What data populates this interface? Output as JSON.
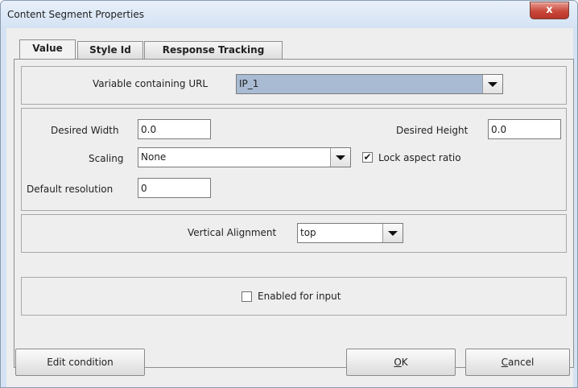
{
  "window": {
    "title": "Content Segment Properties",
    "close_glyph": "x"
  },
  "tabs": [
    {
      "label": "Value",
      "active": true
    },
    {
      "label": "Style Id",
      "active": false
    },
    {
      "label": "Response Tracking",
      "active": false
    }
  ],
  "url_group": {
    "label": "Variable containing URL",
    "value": "IP_1"
  },
  "size_group": {
    "desired_width_label": "Desired Width",
    "desired_width_value": "0.0",
    "desired_height_label": "Desired Height",
    "desired_height_value": "0.0",
    "scaling_label": "Scaling",
    "scaling_value": "None",
    "lock_aspect_label": "Lock aspect ratio",
    "lock_aspect_checked": true,
    "default_resolution_label": "Default resolution",
    "default_resolution_value": "0"
  },
  "alignment_group": {
    "label": "Vertical Alignment",
    "value": "top"
  },
  "input_group": {
    "label": "Enabled for input",
    "checked": false
  },
  "buttons": {
    "edit_condition": "Edit condition",
    "ok_mnemonic": "O",
    "ok_rest": "K",
    "cancel_mnemonic": "C",
    "cancel_rest": "ancel"
  },
  "icons": {
    "close": "close-icon",
    "dropdown": "chevron-down-icon",
    "check": "check-icon"
  }
}
